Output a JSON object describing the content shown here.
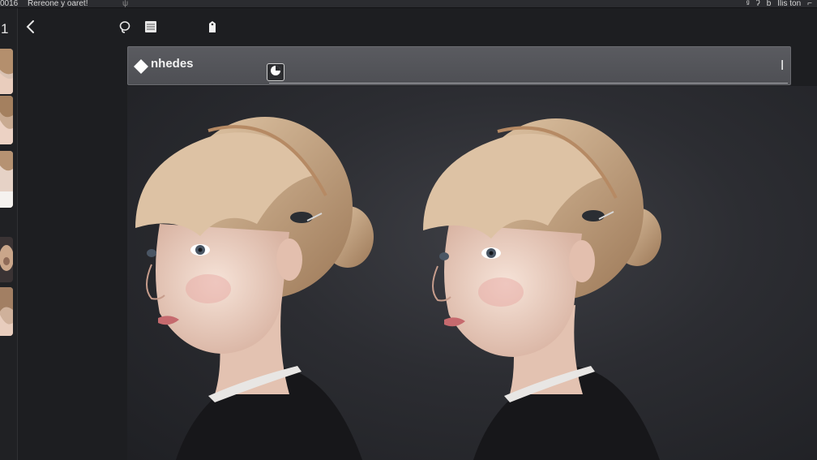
{
  "sysbar": {
    "app_num": "0016",
    "title": "Rereone y oaret!",
    "mark": "ψ",
    "right_items": [
      "ᵍ",
      "ʔ",
      "b",
      "Ilis ton",
      "⌐"
    ]
  },
  "thumbstrip": {
    "page_num": "1"
  },
  "toolbar": {
    "back_icon": "chevron-left-icon",
    "tool_icons": [
      "lasso-icon",
      "layers-icon",
      "tag-icon"
    ]
  },
  "filterbar": {
    "label": "nhedes",
    "end_mark": "l"
  },
  "colors": {
    "background": "#1d1e21",
    "filterbar": "#55565b",
    "canvas": "#2c2d32",
    "hair": "#c8a988",
    "skin": "#efd6c8",
    "garment": "#17171a"
  }
}
